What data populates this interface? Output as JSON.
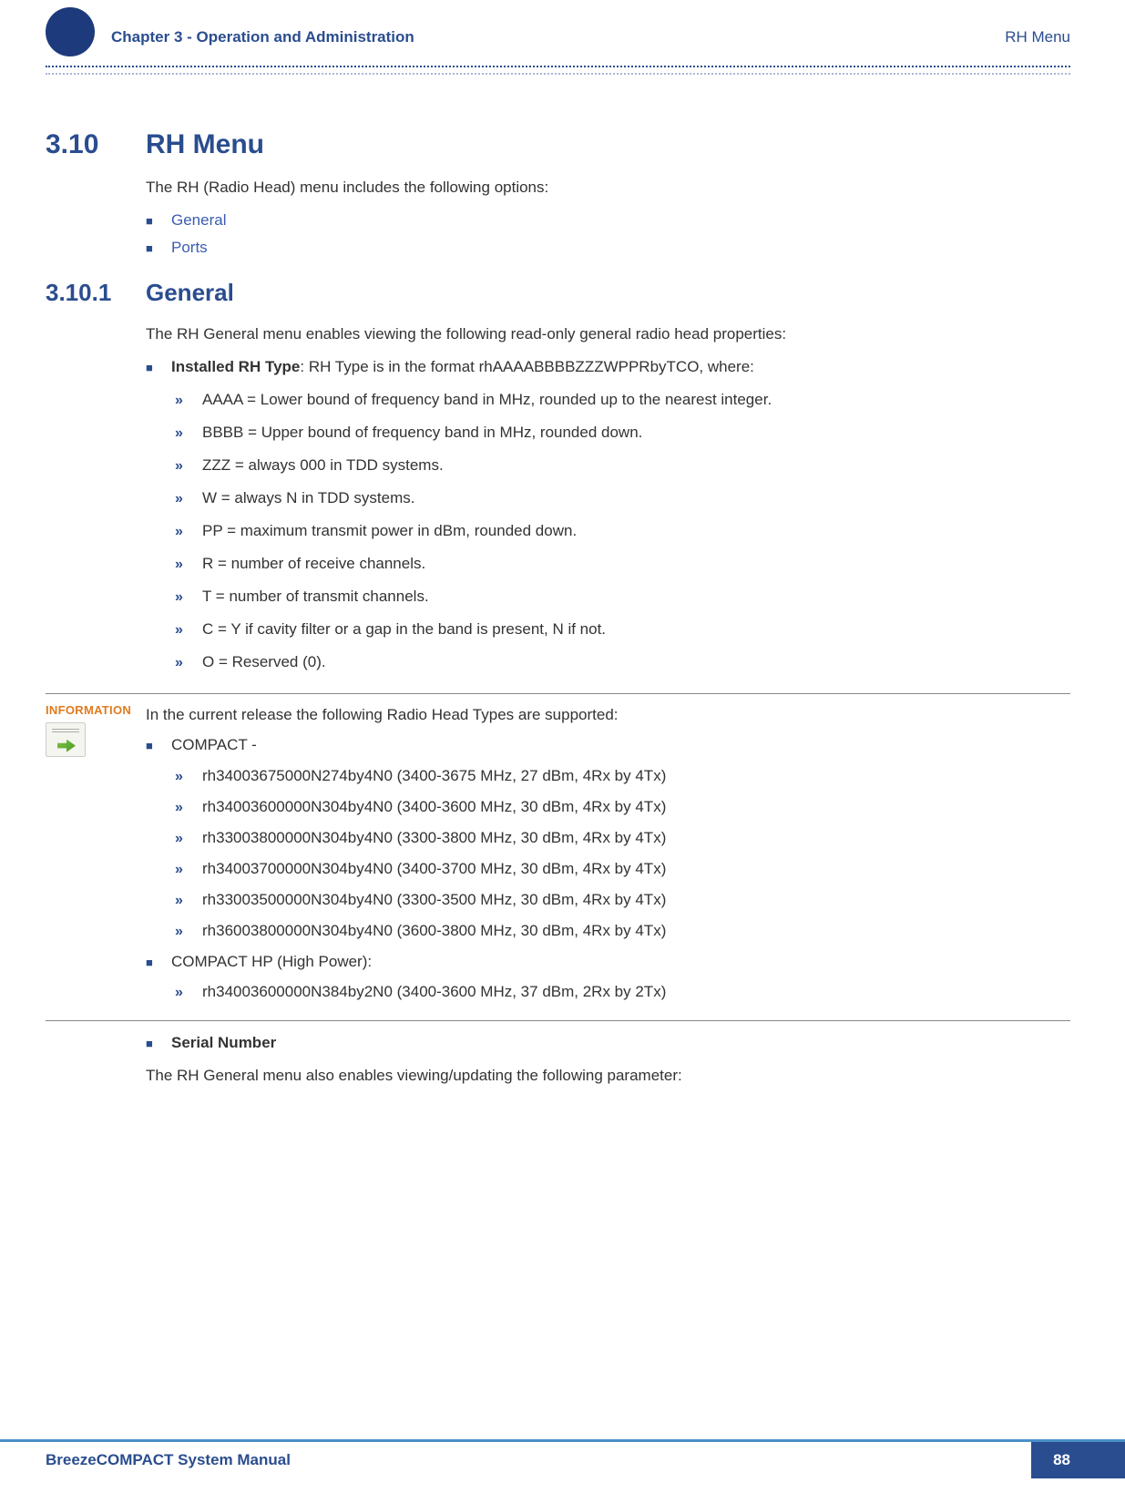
{
  "header": {
    "chapter": "Chapter 3 - Operation and Administration",
    "right": "RH Menu"
  },
  "section": {
    "num": "3.10",
    "title": "RH Menu",
    "intro": "The RH (Radio Head) menu includes the following options:",
    "links": [
      "General",
      "Ports"
    ]
  },
  "subsection": {
    "num": "3.10.1",
    "title": "General",
    "intro": "The RH General menu enables viewing the following read-only general radio head properties:",
    "installed_label": "Installed RH Type",
    "installed_text": ": RH Type is in the format rhAAAABBBBZZZWPPRbyTCO, where:",
    "fields": [
      "AAAA = Lower bound of frequency band in MHz, rounded up to the nearest integer.",
      "BBBB = Upper bound of frequency band in MHz, rounded down.",
      "ZZZ = always 000 in TDD systems.",
      "W = always N in TDD systems.",
      "PP = maximum transmit power in dBm, rounded down.",
      "R = number of receive channels.",
      "T = number of transmit channels.",
      "C = Y if cavity filter or a gap in the band is present, N if not.",
      "O = Reserved (0)."
    ]
  },
  "info": {
    "label": "INFORMATION",
    "lead": "In the current release the following Radio Head Types are supported:",
    "compact_label": "COMPACT -",
    "compact_items": [
      "rh34003675000N274by4N0 (3400-3675 MHz, 27 dBm, 4Rx by 4Tx)",
      "rh34003600000N304by4N0 (3400-3600 MHz, 30 dBm, 4Rx by 4Tx)",
      "rh33003800000N304by4N0 (3300-3800 MHz, 30 dBm, 4Rx by 4Tx)",
      "rh34003700000N304by4N0 (3400-3700 MHz, 30 dBm, 4Rx by 4Tx)",
      "rh33003500000N304by4N0 (3300-3500 MHz, 30 dBm, 4Rx by 4Tx)",
      "rh36003800000N304by4N0 (3600-3800 MHz, 30 dBm, 4Rx by 4Tx)"
    ],
    "hp_label": "COMPACT HP (High Power):",
    "hp_items": [
      "rh34003600000N384by2N0 (3400-3600 MHz, 37 dBm, 2Rx by 2Tx)"
    ]
  },
  "serial": {
    "label": "Serial Number",
    "text": "The RH General menu also enables viewing/updating the following parameter:"
  },
  "footer": {
    "left": "BreezeCOMPACT System Manual",
    "page": "88"
  }
}
